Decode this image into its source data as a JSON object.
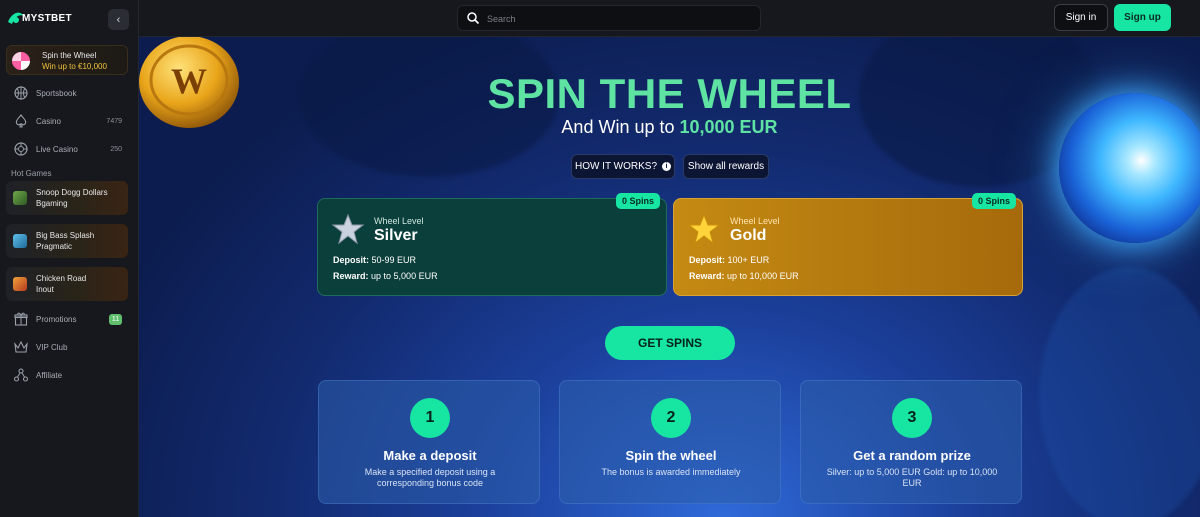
{
  "brand": {
    "logo_text": "MYSTBET"
  },
  "sidebar": {
    "collapse_icon": "chevron-left",
    "promo": {
      "title": "Spin the Wheel",
      "subtitle": "Win up to €10,000"
    },
    "items": [
      {
        "label": "Sportsbook",
        "count": ""
      },
      {
        "label": "Casino",
        "count": "7479"
      },
      {
        "label": "Live Casino",
        "count": "250"
      }
    ],
    "hot_games_label": "Hot Games",
    "hot_games": [
      {
        "name": "Snoop Dogg Dollars",
        "provider": "Bgaming"
      },
      {
        "name": "Big Bass Splash",
        "provider": "Pragmatic"
      },
      {
        "name": "Chicken Road",
        "provider": "Inout"
      }
    ],
    "bottom_items": [
      {
        "label": "Promotions",
        "badge": "11"
      },
      {
        "label": "VIP Club"
      },
      {
        "label": "Affiliate"
      }
    ]
  },
  "header": {
    "search_placeholder": "Search",
    "signin_label": "Sign in",
    "signup_label": "Sign up"
  },
  "hero": {
    "title": "SPIN THE WHEEL",
    "subtitle_prefix": "And Win up to",
    "subtitle_amount": "10,000 EUR",
    "how_it_works": "HOW IT WORKS?",
    "show_rewards": "Show all rewards"
  },
  "wheels": [
    {
      "spins": "0 Spins",
      "level_label": "Wheel Level",
      "name": "Silver",
      "deposit_label": "Deposit:",
      "deposit": "50-99 EUR",
      "reward_label": "Reward:",
      "reward": "up to 5,000 EUR"
    },
    {
      "spins": "0 Spins",
      "level_label": "Wheel Level",
      "name": "Gold",
      "deposit_label": "Deposit:",
      "deposit": "100+ EUR",
      "reward_label": "Reward:",
      "reward": "up to 10,000 EUR"
    }
  ],
  "cta": {
    "get_spins": "GET SPINS"
  },
  "steps": [
    {
      "num": "1",
      "title": "Make a deposit",
      "desc": "Make a specified deposit using a corresponding bonus code"
    },
    {
      "num": "2",
      "title": "Spin the wheel",
      "desc": "The bonus is awarded immediately"
    },
    {
      "num": "3",
      "title": "Get a random prize",
      "desc": "Silver: up to 5,000 EUR  Gold: up to 10,000 EUR"
    }
  ],
  "colors": {
    "accent": "#17e6a3",
    "title_green": "#5ee3a3",
    "gold": "#c48a12",
    "silver_card": "#0b3f3b"
  }
}
